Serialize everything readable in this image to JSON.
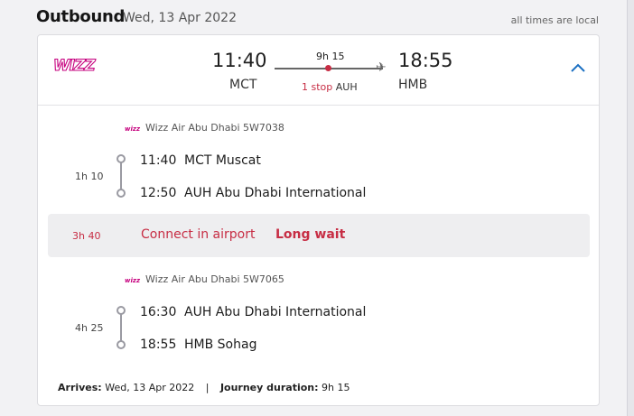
{
  "header": {
    "title": "Outbound",
    "date": "Wed, 13 Apr 2022",
    "note": "all times are local"
  },
  "summary": {
    "logo_text": "WIZZ",
    "departure_time": "11:40",
    "departure_code": "MCT",
    "arrival_time": "18:55",
    "arrival_code": "HMB",
    "duration": "9h 15",
    "stops": "1 stop",
    "stop_code": "AUH",
    "toggle_icon": "chevron-up-icon"
  },
  "segments": [
    {
      "carrier": "Wizz Air Abu Dhabi 5W7038",
      "duration": "1h 10",
      "from_time": "11:40",
      "from_place": "MCT Muscat",
      "to_time": "12:50",
      "to_place": "AUH Abu Dhabi International"
    },
    {
      "carrier": "Wizz Air Abu Dhabi 5W7065",
      "duration": "4h 25",
      "from_time": "16:30",
      "from_place": "AUH Abu Dhabi International",
      "to_time": "18:55",
      "to_place": "HMB Sohag"
    }
  ],
  "layover": {
    "duration": "3h 40",
    "text": "Connect in airport",
    "warning": "Long wait"
  },
  "footer": {
    "arrives_label": "Arrives:",
    "arrives_value": "Wed, 13 Apr 2022",
    "separator": "|",
    "journey_label": "Journey duration:",
    "journey_value": "9h 15"
  },
  "colors": {
    "accent": "#c72d44",
    "link": "#1a6fc2",
    "brand": "#c6007e"
  }
}
